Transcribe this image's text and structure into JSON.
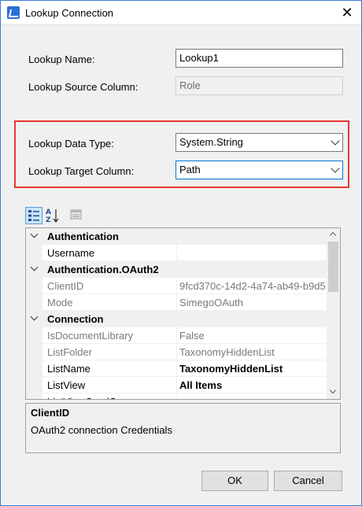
{
  "window": {
    "title": "Lookup Connection",
    "close_glyph": "✕"
  },
  "form": {
    "lookup_name_label": "Lookup Name:",
    "lookup_name_value": "Lookup1",
    "source_column_label": "Lookup Source Column:",
    "source_column_value": "Role",
    "data_type_label": "Lookup Data Type:",
    "data_type_value": "System.String",
    "target_column_label": "Lookup Target Column:",
    "target_column_value": "Path",
    "highlight_color": "#e53935"
  },
  "toolbar": {
    "categorized_icon": "categorized-view-icon",
    "alphabetical_icon": "sort-alphabetical-icon",
    "property_pages_icon": "property-pages-icon"
  },
  "grid": {
    "rows": [
      {
        "type": "category",
        "name": "Authentication"
      },
      {
        "type": "property",
        "name": "Username",
        "value": "",
        "dim": false,
        "bold": false
      },
      {
        "type": "category",
        "name": "Authentication.OAuth2"
      },
      {
        "type": "property",
        "name": "ClientID",
        "value": "9fcd370c-14d2-4a74-ab49-b9d5",
        "dim": true,
        "bold": false
      },
      {
        "type": "property",
        "name": "Mode",
        "value": "SimegoOAuth",
        "dim": true,
        "bold": false
      },
      {
        "type": "category",
        "name": "Connection"
      },
      {
        "type": "property",
        "name": "IsDocumentLibrary",
        "value": "False",
        "dim": true,
        "bold": false
      },
      {
        "type": "property",
        "name": "ListFolder",
        "value": "TaxonomyHiddenList",
        "dim": true,
        "bold": false
      },
      {
        "type": "property",
        "name": "ListName",
        "value": "TaxonomyHiddenList",
        "dim": false,
        "bold": true
      },
      {
        "type": "property",
        "name": "ListView",
        "value": "All Items",
        "dim": false,
        "bold": true
      },
      {
        "type": "property",
        "name": "ListViewCamlQ",
        "value": "",
        "dim": false,
        "bold": false
      }
    ]
  },
  "help": {
    "title": "ClientID",
    "description": "OAuth2 connection Credentials"
  },
  "buttons": {
    "ok": "OK",
    "cancel": "Cancel"
  }
}
